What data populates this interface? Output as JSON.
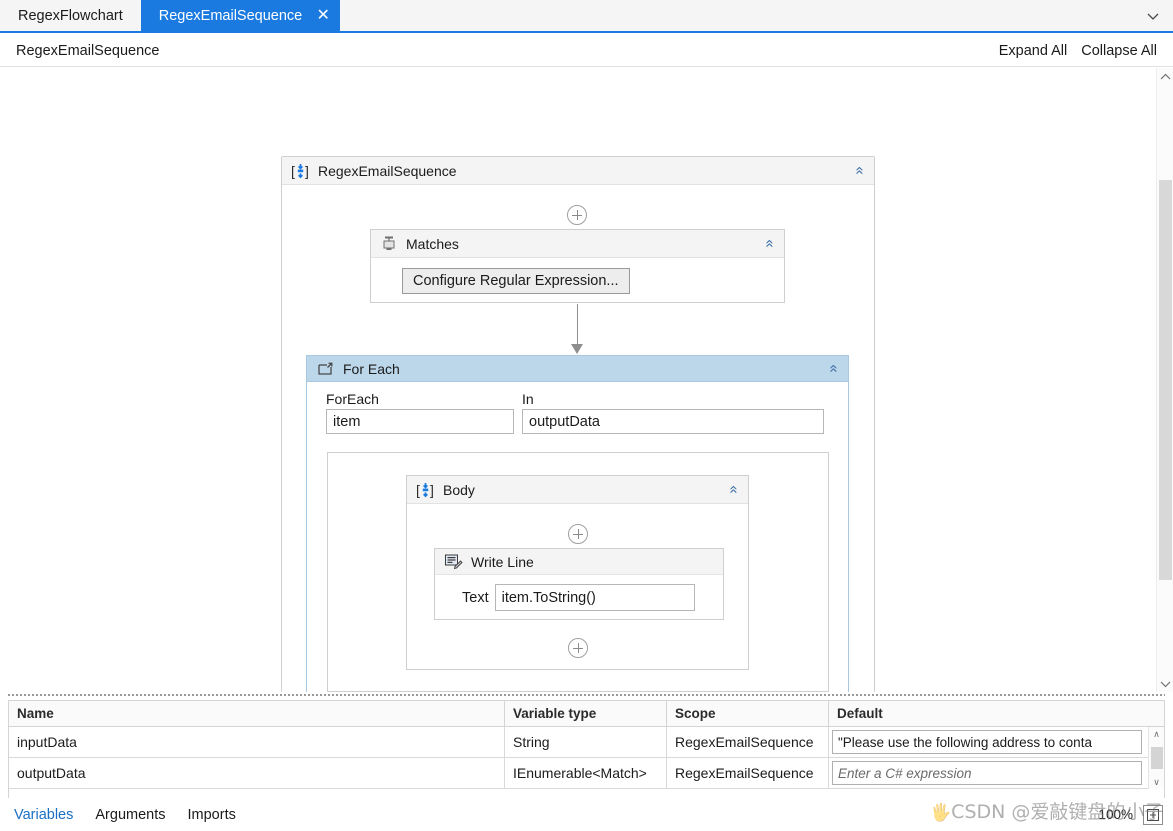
{
  "tabs": [
    {
      "label": "RegexFlowchart",
      "active": false,
      "closable": false
    },
    {
      "label": "RegexEmailSequence",
      "active": true,
      "closable": true,
      "close_glyph": "✕"
    }
  ],
  "tabstrip": {
    "overflow_glyph": "⌄"
  },
  "breadcrumb": {
    "path": "RegexEmailSequence",
    "expand_all": "Expand All",
    "collapse_all": "Collapse All"
  },
  "designer": {
    "root": {
      "title": "RegexEmailSequence",
      "icon": "sequence-icon",
      "collapse_glyph": "«"
    },
    "matches": {
      "title": "Matches",
      "icon": "matches-icon",
      "collapse_glyph": "«",
      "config_button": "Configure Regular Expression..."
    },
    "foreach": {
      "title": "For Each",
      "icon": "foreach-icon",
      "collapse_glyph": "«",
      "foreach_label": "ForEach",
      "foreach_value": "item",
      "in_label": "In",
      "in_value": "outputData",
      "header_color": "#bcd6ea"
    },
    "body": {
      "title": "Body",
      "icon": "sequence-icon",
      "collapse_glyph": "«"
    },
    "writeline": {
      "title": "Write Line",
      "icon": "writeline-icon",
      "text_label": "Text",
      "text_value": "item.ToString()"
    },
    "add_glyph": "+"
  },
  "variables": {
    "columns": [
      "Name",
      "Variable type",
      "Scope",
      "Default"
    ],
    "rows": [
      {
        "name": "inputData",
        "type": "String",
        "scope": "RegexEmailSequence",
        "default": "\"Please use the following address to conta",
        "default_is_placeholder": false
      },
      {
        "name": "outputData",
        "type": "IEnumerable<Match>",
        "scope": "RegexEmailSequence",
        "default": "Enter a C# expression",
        "default_is_placeholder": true
      }
    ],
    "scroll_up_glyph": "∧",
    "scroll_down_glyph": "∨"
  },
  "footer": {
    "tabs": [
      {
        "label": "Variables",
        "active": true
      },
      {
        "label": "Arguments",
        "active": false
      },
      {
        "label": "Imports",
        "active": false
      }
    ],
    "zoom_level": "100%",
    "fit_icon": "fit-to-screen-icon"
  },
  "watermark": {
    "text": "CSDN @爱敲键盘的小子"
  },
  "colors": {
    "tab_active_bg": "#1a7ae0",
    "accent": "#1a7ae0",
    "foreach_header": "#bcd6ea",
    "panel_header": "#f4f4f4",
    "border": "#cfcfcf",
    "link": "#1a6fc4"
  }
}
